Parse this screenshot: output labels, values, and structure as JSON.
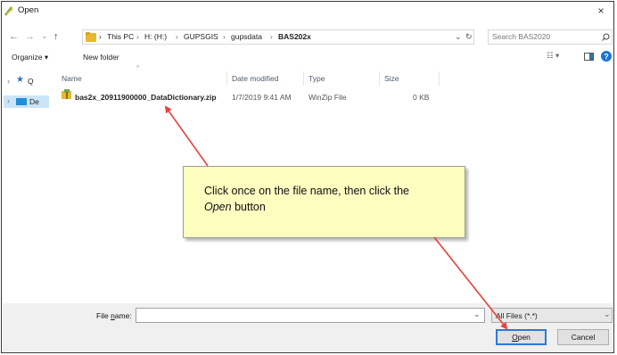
{
  "window": {
    "title": "Open",
    "close_glyph": "×"
  },
  "nav": {
    "back_glyph": "←",
    "forward_glyph": "→",
    "recent_glyph": "⌄",
    "up_glyph": "↑"
  },
  "address": {
    "breadcrumbs": [
      "This PC",
      "H: (H:)",
      "GUPSGIS",
      "gupsdata",
      "BAS202x"
    ],
    "separator": "›",
    "dropdown_glyph": "⌄",
    "refresh_glyph": "↻"
  },
  "search": {
    "placeholder": "Search BAS2020"
  },
  "toolbar": {
    "organize_label": "Organize ▾",
    "new_folder_label": "New folder",
    "view_glyph": "☷ ▾"
  },
  "sidebar": {
    "items": [
      {
        "label": "Q",
        "expander": "›",
        "icon": "star-icon"
      },
      {
        "label": "De",
        "expander": "›",
        "icon": "desktop-icon"
      }
    ]
  },
  "table": {
    "sort_glyph": "^",
    "columns": [
      "Name",
      "Date modified",
      "Type",
      "Size"
    ],
    "rows": [
      {
        "name": "bas2x_20911900000_DataDictionary.zip",
        "date_modified": "1/7/2019 9:41 AM",
        "type": "WinZip File",
        "size": "0 KB"
      }
    ]
  },
  "footer": {
    "file_name_label_prefix": "File ",
    "file_name_label_underlined": "n",
    "file_name_label_suffix": "ame:",
    "file_name_value": "",
    "dropdown_glyph": "⌄",
    "filter_label": "All Files (*.*)",
    "open_button_underlined": "O",
    "open_button_rest": "pen",
    "cancel_label": "Cancel"
  },
  "callout": {
    "line1": "Click once on the file name, then click the",
    "line2_italic": "Open",
    "line2_rest": " button"
  },
  "colors": {
    "callout_fill": "#fdfdc0",
    "arrow_red": "#e8413c",
    "folder_yellow": "#e8b830",
    "help_blue": "#1a73d6"
  }
}
